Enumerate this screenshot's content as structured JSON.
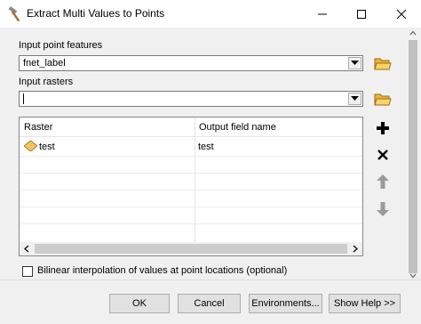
{
  "window": {
    "title": "Extract Multi Values to Points",
    "app_icon": "hammer-icon",
    "controls": {
      "minimize": "minimize-icon",
      "maximize": "maximize-icon",
      "close": "close-icon"
    }
  },
  "form": {
    "input_points_label": "Input point features",
    "input_points_value": "fnet_label",
    "input_rasters_label": "Input rasters",
    "input_rasters_value": "",
    "rasters_table": {
      "columns": [
        "Raster",
        "Output field name"
      ],
      "rows": [
        {
          "raster": "test",
          "output_field": "test",
          "icon": "raster-icon"
        }
      ]
    },
    "side_buttons": [
      "open-folder-icon",
      "add-icon",
      "remove-icon",
      "move-up-icon",
      "move-down-icon"
    ],
    "bilinear_label": "Bilinear interpolation of values at point locations (optional)",
    "bilinear_checked": false
  },
  "buttons": {
    "ok": "OK",
    "cancel": "Cancel",
    "environments": "Environments...",
    "help": "Show Help >>"
  },
  "colors": {
    "window_bg": "#f0f0f0",
    "button_bg": "#e1e1e1",
    "folder_icon": "#e8b43a"
  }
}
